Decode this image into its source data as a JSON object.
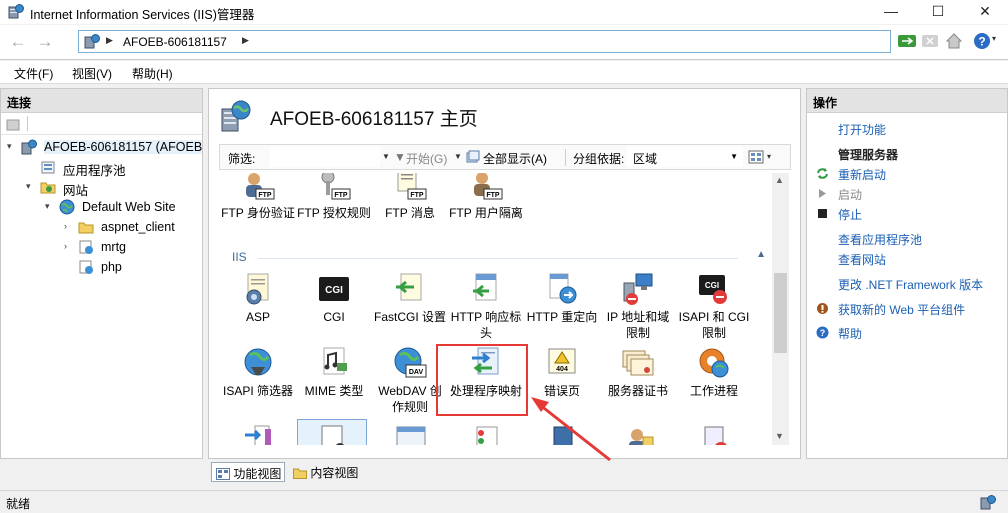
{
  "window": {
    "title": "Internet Information Services (IIS)管理器",
    "min": "—",
    "max": "☐",
    "close": "✕"
  },
  "address": {
    "crumb": "AFOEB-606181157"
  },
  "menu": [
    "文件(F)",
    "视图(V)",
    "帮助(H)"
  ],
  "connections": {
    "header": "连接",
    "tree": [
      {
        "label": "AFOEB-606181157 (AFOEB",
        "toggle": "▾",
        "icon": "server-icon"
      },
      {
        "label": "应用程序池",
        "toggle": "",
        "icon": "app-pool-icon"
      },
      {
        "label": "网站",
        "toggle": "▾",
        "icon": "sites-folder-icon"
      },
      {
        "label": "Default Web Site",
        "toggle": "▾",
        "icon": "globe-icon"
      },
      {
        "label": "aspnet_client",
        "toggle": "›",
        "icon": "folder-icon"
      },
      {
        "label": "mrtg",
        "toggle": "›",
        "icon": "app-icon"
      },
      {
        "label": "php",
        "toggle": "",
        "icon": "app-icon"
      }
    ]
  },
  "main": {
    "title": "AFOEB-606181157 主页",
    "filter": {
      "label": "筛选:",
      "go": "开始(G)",
      "show_all": "全部显示(A)",
      "group_by": "分组依据:",
      "group_value": "区域"
    },
    "ftp_features": [
      {
        "label": "FTP 身份验证",
        "icon": "ftp-auth-icon"
      },
      {
        "label": "FTP 授权规则",
        "icon": "ftp-authz-icon"
      },
      {
        "label": "FTP 消息",
        "icon": "ftp-messages-icon"
      },
      {
        "label": "FTP 用户隔离",
        "icon": "ftp-user-isolation-icon"
      }
    ],
    "group_iis": "IIS",
    "iis_row1": [
      {
        "label": "ASP",
        "icon": "asp-icon"
      },
      {
        "label": "CGI",
        "icon": "cgi-icon"
      },
      {
        "label": "FastCGI 设置",
        "icon": "fastcgi-icon"
      },
      {
        "label": "HTTP 响应标头",
        "icon": "http-headers-icon"
      },
      {
        "label": "HTTP 重定向",
        "icon": "http-redirect-icon"
      },
      {
        "label": "IP 地址和域限制",
        "icon": "ip-restrictions-icon"
      },
      {
        "label": "ISAPI 和 CGI 限制",
        "icon": "isapi-cgi-icon"
      }
    ],
    "iis_row2": [
      {
        "label": "ISAPI 筛选器",
        "icon": "isapi-filters-icon"
      },
      {
        "label": "MIME 类型",
        "icon": "mime-icon"
      },
      {
        "label": "WebDAV 创作规则",
        "icon": "webdav-icon"
      },
      {
        "label": "处理程序映射",
        "icon": "handler-mappings-icon"
      },
      {
        "label": "错误页",
        "icon": "error-pages-icon"
      },
      {
        "label": "服务器证书",
        "icon": "certificates-icon"
      },
      {
        "label": "工作进程",
        "icon": "worker-processes-icon"
      }
    ],
    "tabs": {
      "features": "功能视图",
      "content": "内容视图"
    }
  },
  "actions": {
    "header": "操作",
    "open_feature": "打开功能",
    "manage_server": "管理服务器",
    "restart": "重新启动",
    "start": "启动",
    "stop": "停止",
    "view_app_pools": "查看应用程序池",
    "view_sites": "查看网站",
    "change_net": "更改 .NET Framework 版本",
    "get_web_platform": "获取新的 Web 平台组件",
    "help": "帮助"
  },
  "status": {
    "text": "就绪"
  },
  "colors": {
    "accent": "#1a5fb4",
    "annotation": "#e53935",
    "selection": "#e5f1fb"
  }
}
